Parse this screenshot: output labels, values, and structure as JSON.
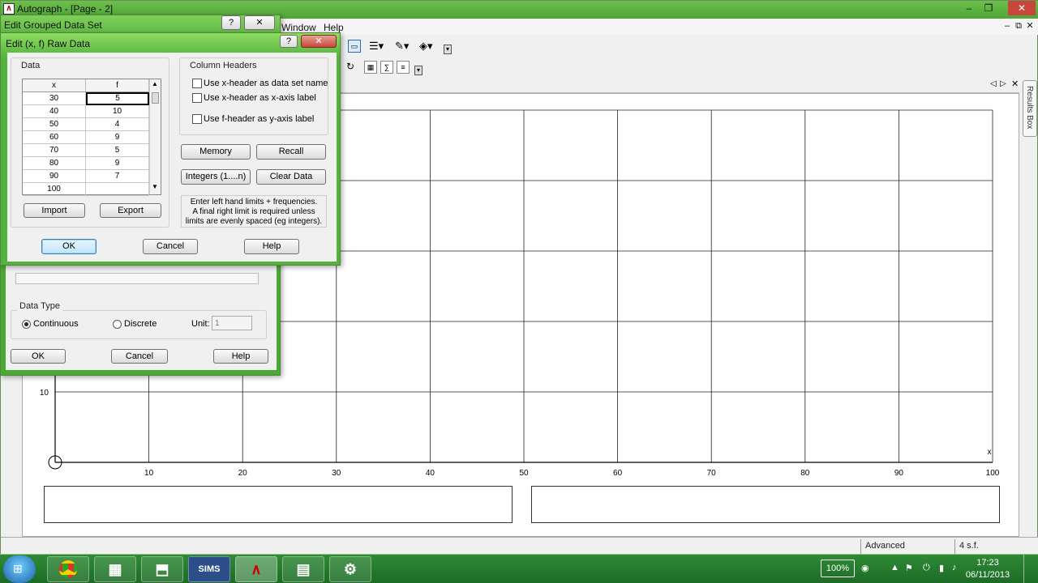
{
  "app": {
    "title": "Autograph - [Page - 2]",
    "menus": {
      "window": "Window",
      "help": "Help"
    },
    "mdi_controls": {
      "minimize": "–",
      "restore": "⧉",
      "close": "✕"
    },
    "window_controls": {
      "minimize": "–",
      "restore": "❐",
      "close": "✕"
    }
  },
  "results_box": {
    "label": "Results Box"
  },
  "graph": {
    "x_axis_label": "x",
    "x_ticks": [
      "10",
      "20",
      "30",
      "40",
      "50",
      "60",
      "70",
      "80",
      "90",
      "100"
    ],
    "y_ticks": [
      "10"
    ],
    "x_range": [
      0,
      100
    ]
  },
  "statusbar": {
    "mode": "Advanced",
    "precision": "4 s.f."
  },
  "grouped_dialog": {
    "title": "Edit Grouped Data Set",
    "help_glyph": "?",
    "close_glyph": "✕",
    "data_type_label": "Data Type",
    "continuous_label": "Continuous",
    "discrete_label": "Discrete",
    "unit_label": "Unit:",
    "unit_value": "1",
    "selected_type": "Continuous",
    "ok_label": "OK",
    "cancel_label": "Cancel",
    "help_label": "Help"
  },
  "raw_dialog": {
    "title": "Edit (x, f) Raw Data",
    "help_glyph": "?",
    "close_glyph": "✕",
    "data_group_label": "Data",
    "col_x": "x",
    "col_f": "f",
    "rows": [
      {
        "x": "30",
        "f": "5"
      },
      {
        "x": "40",
        "f": "10"
      },
      {
        "x": "50",
        "f": "4"
      },
      {
        "x": "60",
        "f": "9"
      },
      {
        "x": "70",
        "f": "5"
      },
      {
        "x": "80",
        "f": "9"
      },
      {
        "x": "90",
        "f": "7"
      },
      {
        "x": "100",
        "f": ""
      }
    ],
    "column_headers_label": "Column Headers",
    "chk_x_name": "Use x-header as data set name",
    "chk_x_axis": "Use x-header as x-axis label",
    "chk_f_axis": "Use f-header as y-axis label",
    "memory_label": "Memory",
    "recall_label": "Recall",
    "integers_label": "Integers (1....n)",
    "clear_label": "Clear Data",
    "hint_line1": "Enter left hand limits + frequencies.",
    "hint_line2": "A final right limit is required unless",
    "hint_line3": "limits are evenly spaced (eg integers).",
    "import_label": "Import",
    "export_label": "Export",
    "ok_label": "OK",
    "cancel_label": "Cancel",
    "help_label": "Help"
  },
  "taskbar": {
    "sims_label": "SIMS",
    "battery": "100%",
    "time": "17:23",
    "date": "06/11/2013"
  }
}
